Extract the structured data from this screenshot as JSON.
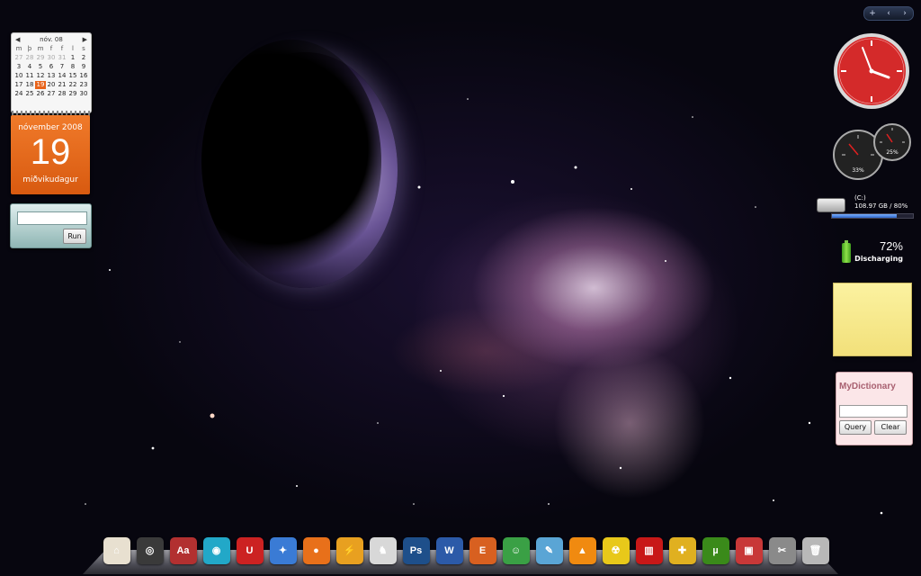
{
  "calendar_gadget": {
    "month_label": "nóv. 08",
    "weekday_headers": [
      "m",
      "þ",
      "m",
      "f",
      "f",
      "l",
      "s"
    ],
    "weeks": [
      [
        "27",
        "28",
        "29",
        "30",
        "31",
        "1",
        "2"
      ],
      [
        "3",
        "4",
        "5",
        "6",
        "7",
        "8",
        "9"
      ],
      [
        "10",
        "11",
        "12",
        "13",
        "14",
        "15",
        "16"
      ],
      [
        "17",
        "18",
        "19",
        "20",
        "21",
        "22",
        "23"
      ],
      [
        "24",
        "25",
        "26",
        "27",
        "28",
        "29",
        "30"
      ]
    ],
    "today": "19",
    "big_month": "nóvember 2008",
    "big_day": "19",
    "big_weekday": "miðvikudagur"
  },
  "run_gadget": {
    "button_label": "Run"
  },
  "sidebar_control": {
    "add": "+",
    "prev": "‹",
    "next": "›"
  },
  "drive": {
    "name": "(C:)",
    "usage": "108.97 GB / 80%",
    "used_fraction": 0.8
  },
  "battery": {
    "percent": "72%",
    "status": "Discharging"
  },
  "gauges": {
    "cpu_label": "33%",
    "mem_label": "25%"
  },
  "dictionary": {
    "title": "MyDictionary",
    "query_label": "Query",
    "clear_label": "Clear"
  },
  "dock": [
    {
      "name": "home-icon",
      "glyph": "⌂",
      "color": "#e8e0d0"
    },
    {
      "name": "dashboard-gauge-icon",
      "glyph": "◎",
      "color": "#3a3a3a"
    },
    {
      "name": "dictionary-book-icon",
      "glyph": "Aa",
      "color": "#b23030"
    },
    {
      "name": "swirl-app-icon",
      "glyph": "◉",
      "color": "#22a8c8"
    },
    {
      "name": "magnet-icon",
      "glyph": "U",
      "color": "#cc2222"
    },
    {
      "name": "safari-compass-icon",
      "glyph": "✦",
      "color": "#3a7bd5"
    },
    {
      "name": "firefox-icon",
      "glyph": "●",
      "color": "#e8701a"
    },
    {
      "name": "winamp-icon",
      "glyph": "⚡",
      "color": "#e8a020"
    },
    {
      "name": "counter-strike-icon",
      "glyph": "♞",
      "color": "#d8d8d8"
    },
    {
      "name": "photoshop-icon",
      "glyph": "Ps",
      "color": "#1e4f8a"
    },
    {
      "name": "word-icon",
      "glyph": "W",
      "color": "#2c5aa8"
    },
    {
      "name": "office-icon",
      "glyph": "E",
      "color": "#d86020"
    },
    {
      "name": "messenger-icon",
      "glyph": "☺",
      "color": "#3aa045"
    },
    {
      "name": "notepad-icon",
      "glyph": "✎",
      "color": "#5aa5d5"
    },
    {
      "name": "vlc-cone-icon",
      "glyph": "▲",
      "color": "#f08a10"
    },
    {
      "name": "radioactive-icon",
      "glyph": "☢",
      "color": "#e8c81a"
    },
    {
      "name": "red-curtain-icon",
      "glyph": "▥",
      "color": "#c81818"
    },
    {
      "name": "tools-puzzle-icon",
      "glyph": "✚",
      "color": "#e0b020"
    },
    {
      "name": "utorrent-icon",
      "glyph": "µ",
      "color": "#3a8a1a"
    },
    {
      "name": "archive-icon",
      "glyph": "▣",
      "color": "#c83838"
    },
    {
      "name": "settings-tools-icon",
      "glyph": "✂",
      "color": "#8a8a8a"
    },
    {
      "name": "trash-icon",
      "glyph": "🗑",
      "color": "#b8b8b8"
    }
  ]
}
